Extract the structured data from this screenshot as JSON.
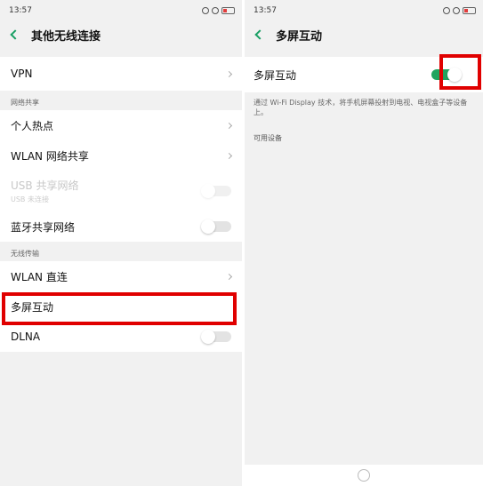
{
  "left": {
    "status": {
      "time": "13:57",
      "signal": "ᯤ",
      "battery": "20"
    },
    "title": "其他无线连接",
    "vpn": {
      "label": "VPN"
    },
    "network_sharing": {
      "section_label": "网络共享",
      "hotspot": "个人热点",
      "wlan_share": "WLAN 网络共享",
      "usb_share": "USB 共享网络",
      "usb_sub": "USB 未连接",
      "bt_share": "蓝牙共享网络"
    },
    "wireless": {
      "section_label": "无线传输",
      "wlan_direct": "WLAN 直连",
      "multi_screen": "多屏互动",
      "dlna": "DLNA"
    }
  },
  "right": {
    "status": {
      "time": "13:57",
      "battery": "20"
    },
    "title": "多屏互动",
    "toggle_label": "多屏互动",
    "toggle_state": true,
    "description": "通过 Wi-Fi Display 技术，将手机屏幕投射到电视、电视盒子等设备上。",
    "available_label": "可用设备"
  },
  "colors": {
    "accent": "#21a45f",
    "highlight": "#e00000"
  }
}
